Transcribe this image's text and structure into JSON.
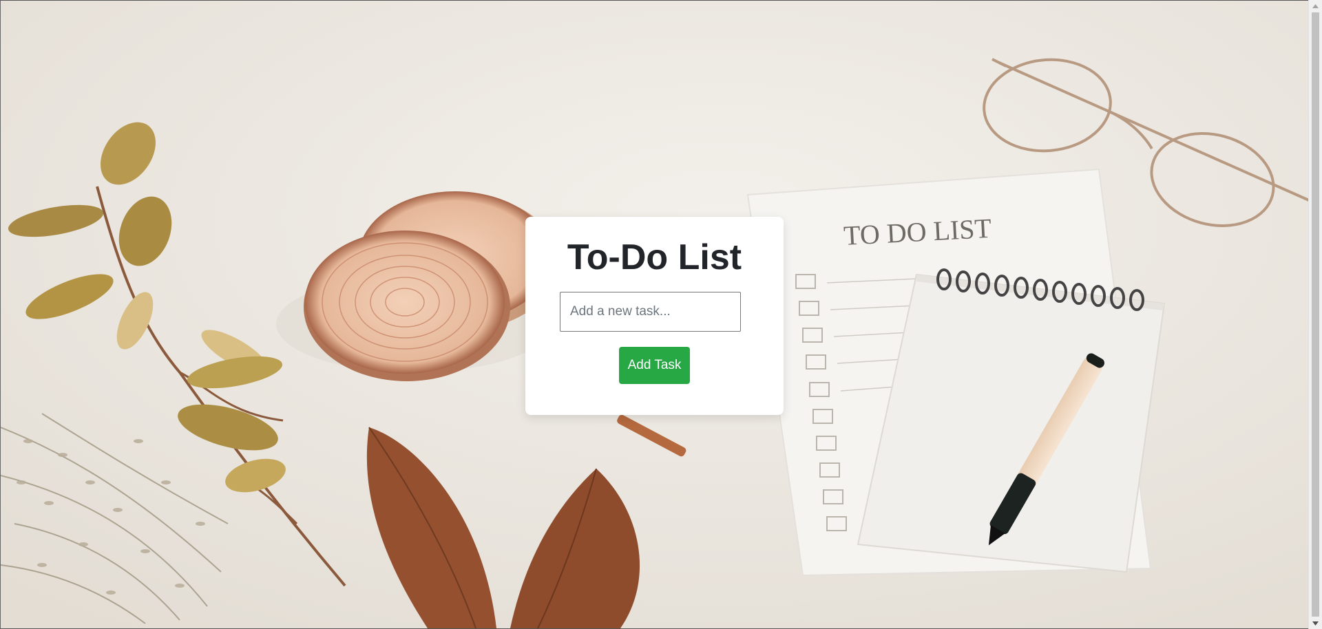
{
  "page": {
    "title": "To-Do List",
    "background_photo_text": "TO DO LIST"
  },
  "form": {
    "input_placeholder": "Add a new task...",
    "input_value": "",
    "add_button_label": "Add Task"
  },
  "tasks": [],
  "colors": {
    "button": "#28a745",
    "card": "#ffffff",
    "title": "#212529",
    "background": "#ece8e1"
  },
  "icons": {
    "scroll_up": "triangle-up-icon",
    "scroll_down": "triangle-down-icon"
  }
}
